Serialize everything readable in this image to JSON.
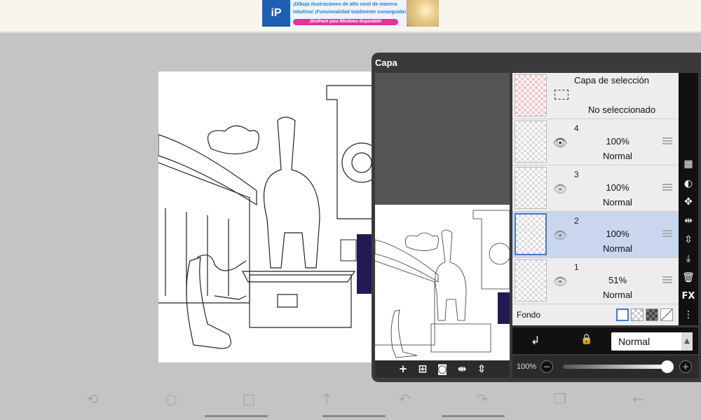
{
  "ad": {
    "logo": "iP",
    "line1": "¡Dibuja ilustraciones de alto nivel de manera",
    "line2": "intuitiva! ¡Funcionalidad totalmente conseguida!",
    "cta": "¡ibisPaint para Windows disponible!"
  },
  "layer_panel": {
    "title": "Capa",
    "selection_layer": {
      "title": "Capa de selección",
      "status": "No seleccionado"
    },
    "layers": [
      {
        "number": "4",
        "opacity": "100%",
        "blend": "Normal",
        "visible_icon": "eye-icon"
      },
      {
        "number": "3",
        "opacity": "100%",
        "blend": "Normal",
        "visible_icon": "eye-icon"
      },
      {
        "number": "2",
        "opacity": "100%",
        "blend": "Normal",
        "visible_icon": "eye-icon",
        "selected": true
      },
      {
        "number": "1",
        "opacity": "51%",
        "blend": "Normal",
        "visible_icon": "eye-icon"
      }
    ],
    "background_label": "Fondo",
    "blend_mode": "Normal",
    "opacity_label": "100%",
    "fx_label": "FX"
  },
  "colors": {
    "selected_layer": "#c9d6ee",
    "panel_bg": "#3a3a3a",
    "canvas_bg": "#c4c4c4"
  }
}
